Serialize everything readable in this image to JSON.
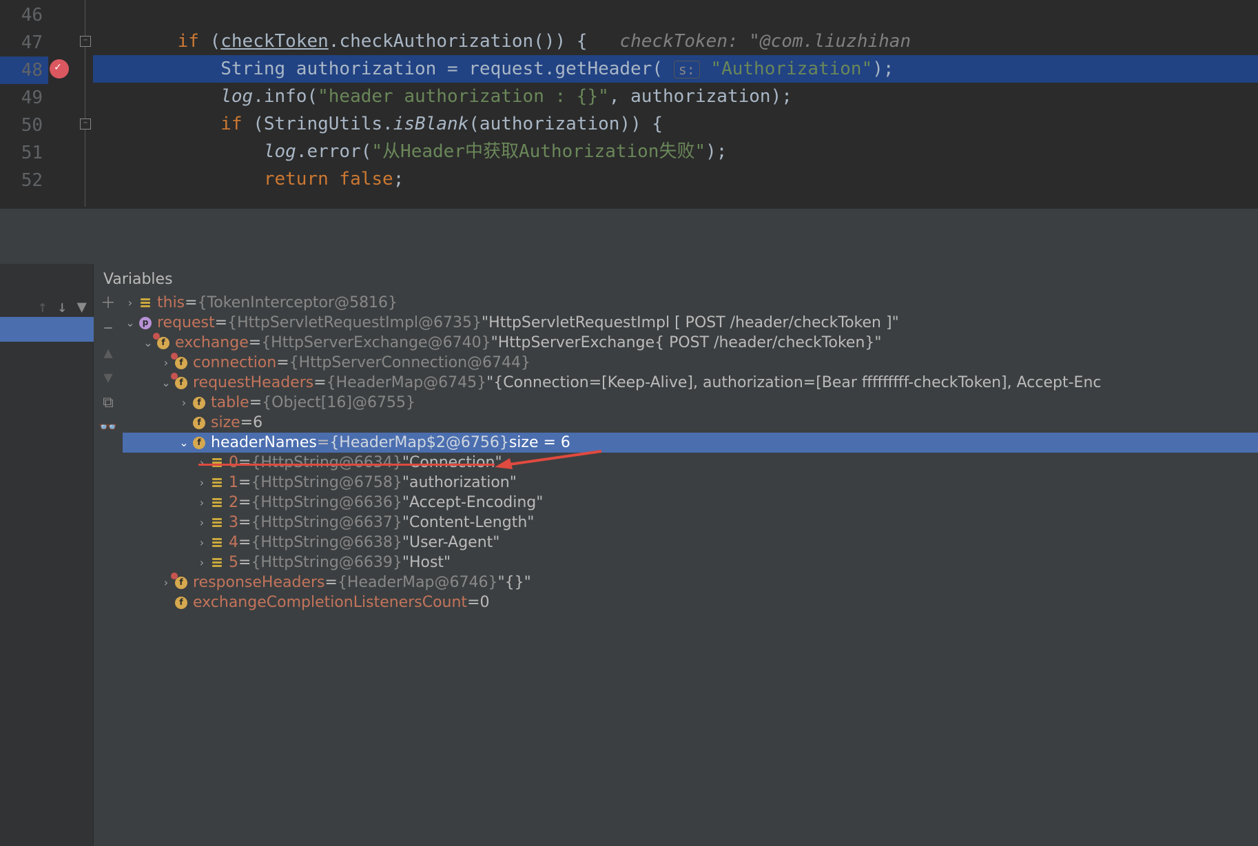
{
  "gutter": [
    "46",
    "47",
    "48",
    "49",
    "50",
    "51",
    "52"
  ],
  "code": {
    "l47_if": "if",
    "l47_check": "checkToken",
    "l47_rest": ".checkAuthorization()) {",
    "l47_hint": "checkToken: \"@com.liuzhihan",
    "l48_pre": "String authorization = request.getHeader(",
    "l48_s": "s:",
    "l48_str": "\"Authorization\"",
    "l48_end": ");",
    "l49_log": "log",
    "l49_info": ".info(",
    "l49_str": "\"header authorization : {}\"",
    "l49_end": ", authorization);",
    "l50_if": "if",
    "l50_open": " (StringUtils.",
    "l50_isblank": "isBlank",
    "l50_rest": "(authorization)) {",
    "l51_log": "log",
    "l51_err": ".error(",
    "l51_str": "\"从Header中获取Authorization失败\"",
    "l51_end": ");",
    "l52_ret": "return false",
    "l52_semi": ";"
  },
  "panel": {
    "tab": "Variables"
  },
  "tree": [
    {
      "indent": 0,
      "arrow": "right",
      "icon": "obj",
      "name": "this",
      "eq": " = ",
      "type": "{TokenInterceptor@5816}",
      "val": ""
    },
    {
      "indent": 0,
      "arrow": "down",
      "icon": "p",
      "name": "request",
      "eq": " = ",
      "type": "{HttpServletRequestImpl@6735} ",
      "val": "\"HttpServletRequestImpl [ POST /header/checkToken ]\""
    },
    {
      "indent": 1,
      "arrow": "down",
      "icon": "f",
      "badge": true,
      "name": "exchange",
      "eq": " = ",
      "type": "{HttpServerExchange@6740} ",
      "val": "\"HttpServerExchange{ POST /header/checkToken}\""
    },
    {
      "indent": 2,
      "arrow": "right",
      "icon": "f",
      "badge": true,
      "name": "connection",
      "eq": " = ",
      "type": "{HttpServerConnection@6744}",
      "val": ""
    },
    {
      "indent": 2,
      "arrow": "down",
      "icon": "f",
      "badge": true,
      "name": "requestHeaders",
      "eq": " = ",
      "type": "{HeaderMap@6745} ",
      "val": "\"{Connection=[Keep-Alive], authorization=[Bear fffffffff-checkToken], Accept-Enc"
    },
    {
      "indent": 3,
      "arrow": "right",
      "icon": "f",
      "name": "table",
      "eq": " = ",
      "type": "{Object[16]@6755}",
      "val": ""
    },
    {
      "indent": 3,
      "arrow": "none",
      "icon": "f",
      "name": "size",
      "eq": " = ",
      "type": "",
      "val": "6"
    },
    {
      "indent": 3,
      "arrow": "down",
      "icon": "f",
      "name": "headerNames",
      "eq": " = ",
      "type": "{HeaderMap$2@6756}  ",
      "val": "size = 6",
      "selected": true
    },
    {
      "indent": 4,
      "arrow": "right",
      "icon": "obj",
      "name": "0",
      "eq": " = ",
      "type": "{HttpString@6634} ",
      "val": "\"Connection\""
    },
    {
      "indent": 4,
      "arrow": "right",
      "icon": "obj",
      "name": "1",
      "eq": " = ",
      "type": "{HttpString@6758} ",
      "val": "\"authorization\""
    },
    {
      "indent": 4,
      "arrow": "right",
      "icon": "obj",
      "name": "2",
      "eq": " = ",
      "type": "{HttpString@6636} ",
      "val": "\"Accept-Encoding\""
    },
    {
      "indent": 4,
      "arrow": "right",
      "icon": "obj",
      "name": "3",
      "eq": " = ",
      "type": "{HttpString@6637} ",
      "val": "\"Content-Length\""
    },
    {
      "indent": 4,
      "arrow": "right",
      "icon": "obj",
      "name": "4",
      "eq": " = ",
      "type": "{HttpString@6638} ",
      "val": "\"User-Agent\""
    },
    {
      "indent": 4,
      "arrow": "right",
      "icon": "obj",
      "name": "5",
      "eq": " = ",
      "type": "{HttpString@6639} ",
      "val": "\"Host\""
    },
    {
      "indent": 2,
      "arrow": "right",
      "icon": "f",
      "badge": true,
      "name": "responseHeaders",
      "eq": " = ",
      "type": "{HeaderMap@6746} ",
      "val": "\"{}\""
    },
    {
      "indent": 2,
      "arrow": "none",
      "icon": "f",
      "name": "exchangeCompletionListenersCount",
      "eq": " = ",
      "type": "",
      "val": "0"
    }
  ]
}
